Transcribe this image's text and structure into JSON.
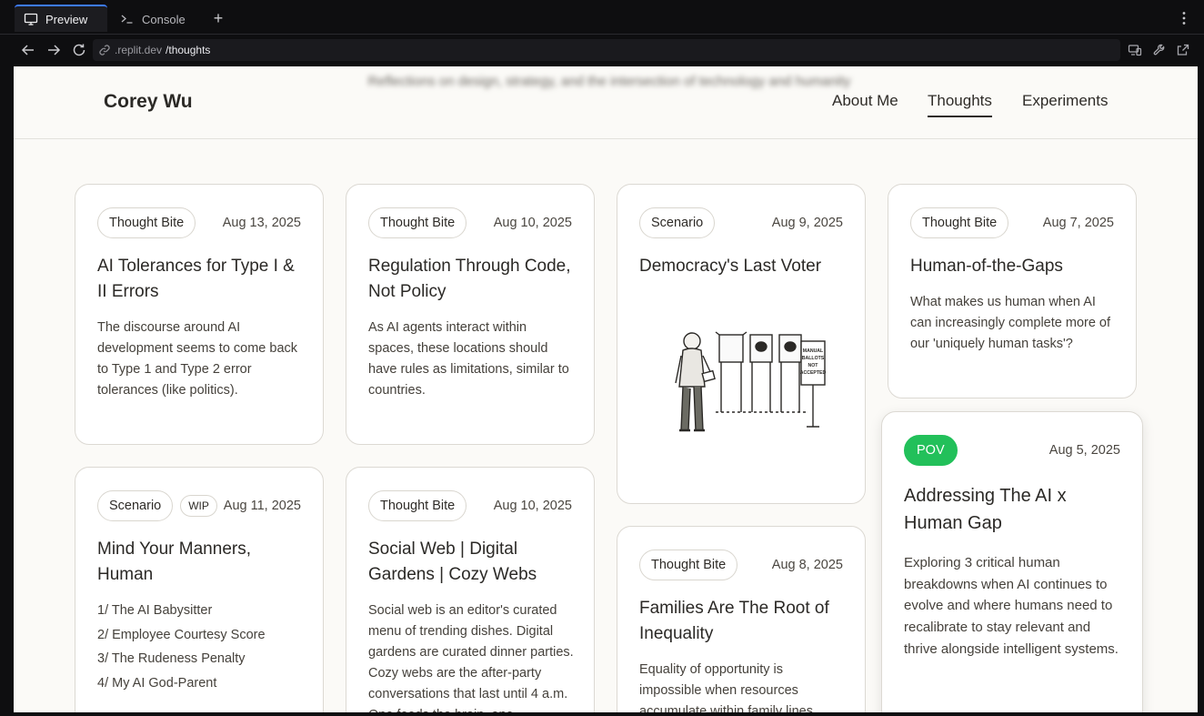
{
  "chrome": {
    "tabs": [
      {
        "label": "Preview",
        "icon": "monitor-icon",
        "active": true
      },
      {
        "label": "Console",
        "icon": "terminal-icon",
        "active": false
      }
    ],
    "url_host": ".replit.dev",
    "url_path": "/thoughts"
  },
  "site": {
    "brand": "Corey Wu",
    "tagline": "Reflections on design, strategy, and the intersection of technology and humanity",
    "nav": [
      "About Me",
      "Thoughts",
      "Experiments"
    ],
    "active_nav": "Thoughts"
  },
  "cards": [
    {
      "tag": "Thought Bite",
      "date": "Aug 13, 2025",
      "title": "AI Tolerances for Type I & II Errors",
      "excerpt": "The discourse around AI development seems to come back to Type 1 and Type 2 error tolerances (like politics)."
    },
    {
      "tag": "Thought Bite",
      "date": "Aug 10, 2025",
      "title": "Regulation Through Code, Not Policy",
      "excerpt": "As AI agents interact within spaces, these locations should have rules as limitations, similar to countries."
    },
    {
      "tag": "Scenario",
      "date": "Aug 9, 2025",
      "title": "Democracy's Last Voter",
      "image_sign": "MANUAL BALLOTS NOT ACCEPTED"
    },
    {
      "tag": "Thought Bite",
      "date": "Aug 7, 2025",
      "title": "Human-of-the-Gaps",
      "excerpt": "What makes us human when AI can increasingly complete more of our 'uniquely human tasks'?"
    },
    {
      "tag": "Scenario",
      "extra_tag": "WIP",
      "date": "Aug 11, 2025",
      "title": "Mind Your Manners, Human",
      "list": [
        "1/ The AI Babysitter",
        "2/ Employee Courtesy Score",
        "3/ The Rudeness Penalty",
        "4/ My AI God-Parent"
      ]
    },
    {
      "tag": "Thought Bite",
      "date": "Aug 10, 2025",
      "title": "Social Web | Digital Gardens | Cozy Webs",
      "excerpt": "Social web is an editor's curated menu of trending dishes. Digital gardens are curated dinner parties. Cozy webs are the after-party conversations that last until 4 a.m. One feeds the brain, one"
    },
    {
      "tag": "Thought Bite",
      "date": "Aug 8, 2025",
      "title": "Families Are The Root of Inequality",
      "excerpt": "Equality of opportunity is impossible when resources accumulate within family lines"
    },
    {
      "tag": "POV",
      "date": "Aug 5, 2025",
      "title": "Addressing The AI x Human Gap",
      "excerpt": "Exploring 3 critical human breakdowns when AI continues to evolve and where humans need to recalibrate to stay relevant and thrive alongside intelligent systems."
    }
  ],
  "colors": {
    "accent_pov": "#22c05a",
    "tab_accent": "#3d7bfd",
    "page_bg": "#fbfaf7"
  }
}
